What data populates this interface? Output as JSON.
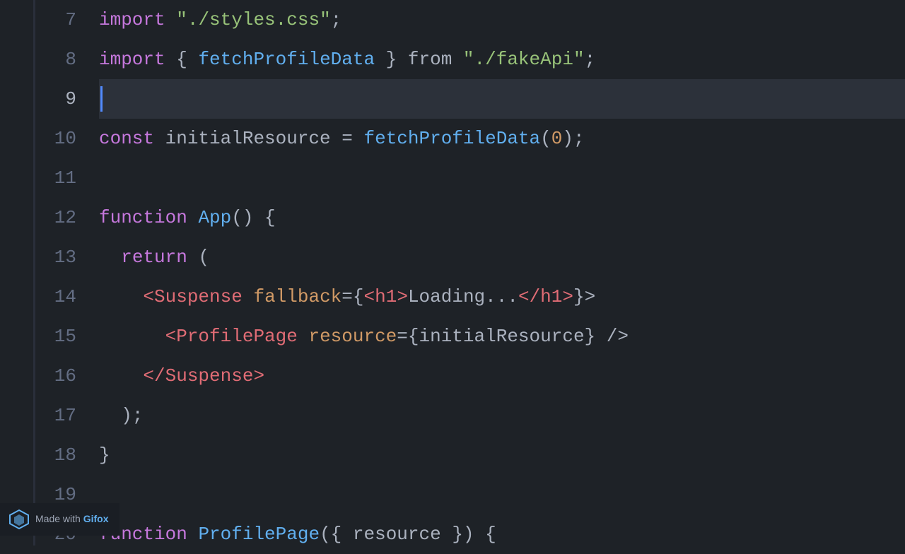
{
  "editor": {
    "background": "#1e2227",
    "lines": [
      {
        "number": "7",
        "active": false,
        "tokens": [
          {
            "type": "kw-import",
            "text": "import"
          },
          {
            "type": "plain",
            "text": " "
          },
          {
            "type": "str",
            "text": "\"./styles.css\""
          },
          {
            "type": "plain",
            "text": ";"
          }
        ]
      },
      {
        "number": "8",
        "active": false,
        "tokens": [
          {
            "type": "kw-import",
            "text": "import"
          },
          {
            "type": "plain",
            "text": " { "
          },
          {
            "type": "fn",
            "text": "fetchProfileData"
          },
          {
            "type": "plain",
            "text": " } "
          },
          {
            "type": "plain",
            "text": "from"
          },
          {
            "type": "plain",
            "text": " "
          },
          {
            "type": "str",
            "text": "\"./fakeApi\""
          },
          {
            "type": "plain",
            "text": ";"
          }
        ]
      },
      {
        "number": "9",
        "active": true,
        "tokens": []
      },
      {
        "number": "10",
        "active": false,
        "tokens": [
          {
            "type": "const-kw",
            "text": "const"
          },
          {
            "type": "plain",
            "text": " "
          },
          {
            "type": "plain",
            "text": "initialResource"
          },
          {
            "type": "plain",
            "text": " = "
          },
          {
            "type": "fn-call",
            "text": "fetchProfileData"
          },
          {
            "type": "plain",
            "text": "("
          },
          {
            "type": "num",
            "text": "0"
          },
          {
            "type": "plain",
            "text": ");"
          }
        ]
      },
      {
        "number": "11",
        "active": false,
        "tokens": []
      },
      {
        "number": "12",
        "active": false,
        "tokens": [
          {
            "type": "kw-import",
            "text": "function"
          },
          {
            "type": "plain",
            "text": " "
          },
          {
            "type": "fn",
            "text": "App"
          },
          {
            "type": "plain",
            "text": "() {"
          }
        ]
      },
      {
        "number": "13",
        "active": false,
        "indent": "  ",
        "tokens": [
          {
            "type": "kw-import",
            "text": "return"
          },
          {
            "type": "plain",
            "text": " ("
          }
        ]
      },
      {
        "number": "14",
        "active": false,
        "indent": "    ",
        "tokens": [
          {
            "type": "jsx-tag",
            "text": "<Suspense"
          },
          {
            "type": "plain",
            "text": " "
          },
          {
            "type": "jsx-attr",
            "text": "fallback"
          },
          {
            "type": "plain",
            "text": "={"
          },
          {
            "type": "jsx-tag",
            "text": "<h1"
          },
          {
            "type": "jsx-tag",
            "text": ">"
          },
          {
            "type": "plain",
            "text": "Loading..."
          },
          {
            "type": "jsx-tag",
            "text": "</h1"
          },
          {
            "type": "jsx-tag",
            "text": ">"
          },
          {
            "type": "plain",
            "text": "}>"
          }
        ]
      },
      {
        "number": "15",
        "active": false,
        "indent": "      ",
        "tokens": [
          {
            "type": "jsx-tag",
            "text": "<ProfilePage"
          },
          {
            "type": "plain",
            "text": " "
          },
          {
            "type": "jsx-attr",
            "text": "resource"
          },
          {
            "type": "plain",
            "text": "={initialResource} />"
          }
        ]
      },
      {
        "number": "16",
        "active": false,
        "indent": "    ",
        "tokens": [
          {
            "type": "jsx-tag",
            "text": "</Suspense"
          },
          {
            "type": "jsx-tag",
            "text": ">"
          }
        ]
      },
      {
        "number": "17",
        "active": false,
        "indent": "  ",
        "tokens": [
          {
            "type": "plain",
            "text": ");"
          }
        ]
      },
      {
        "number": "18",
        "active": false,
        "tokens": [
          {
            "type": "plain",
            "text": "}"
          }
        ]
      },
      {
        "number": "19",
        "active": false,
        "tokens": []
      },
      {
        "number": "20",
        "active": false,
        "tokens": [
          {
            "type": "kw-import",
            "text": "function"
          },
          {
            "type": "plain",
            "text": " "
          },
          {
            "type": "fn",
            "text": "ProfilePage"
          },
          {
            "type": "plain",
            "text": "({ "
          },
          {
            "type": "plain",
            "text": "resource"
          },
          {
            "type": "plain",
            "text": " }) {"
          }
        ]
      }
    ]
  },
  "watermark": {
    "text": "Made with ",
    "brand": "Gifox"
  }
}
